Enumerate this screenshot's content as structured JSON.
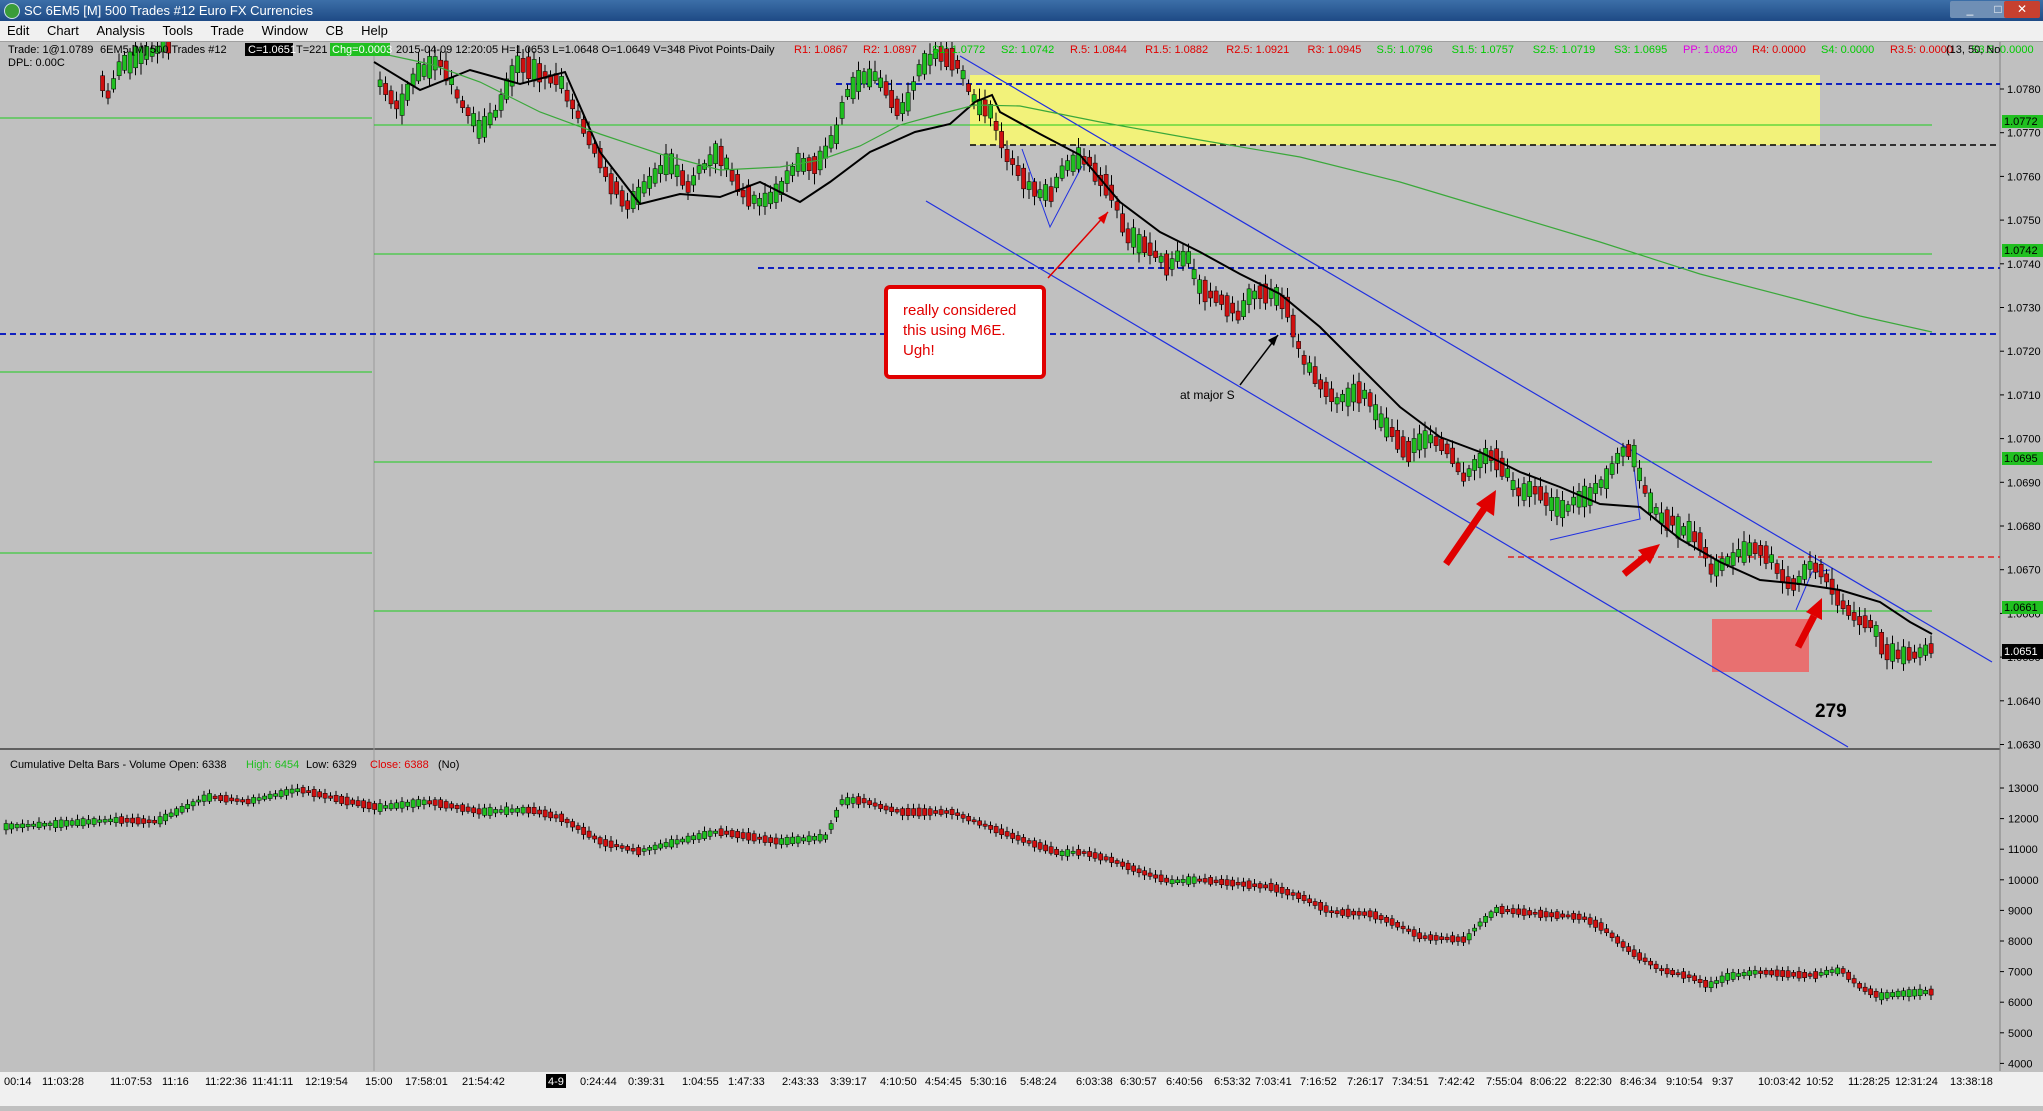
{
  "window": {
    "title": "SC 6EM5 [M]  500 Trades  #12  Euro FX Currencies",
    "minimize": "_",
    "maximize": "□",
    "close": "✕"
  },
  "menu": [
    "Edit",
    "Chart",
    "Analysis",
    "Tools",
    "Trade",
    "Window",
    "CB",
    "Help"
  ],
  "header": {
    "trade": "Trade: 1@1.0789",
    "symbol": "6EM5 [M]  500 Trades  #12",
    "price_box": "C=1.0651",
    "ticks": "T=221",
    "change_box": "Chg=0.0003",
    "ohlc": "2015-04-09 12:20:05 H=1.0653 L=1.0648 O=1.0649 V=348 Pivot Points-Daily",
    "dpl": "DPL: 0.00C",
    "settings": "(13, 50, No",
    "pivots": [
      {
        "text": "R1: 1.0867",
        "color": "#e00000"
      },
      {
        "text": "R2: 1.0897",
        "color": "#e00000"
      },
      {
        "text": "S1: 1.0772",
        "color": "#00cc00"
      },
      {
        "text": "S2: 1.0742",
        "color": "#00cc00"
      },
      {
        "text": "R.5: 1.0844",
        "color": "#e00000"
      },
      {
        "text": "R1.5: 1.0882",
        "color": "#e00000"
      },
      {
        "text": "R2.5: 1.0921",
        "color": "#e00000"
      },
      {
        "text": "R3: 1.0945",
        "color": "#e00000"
      },
      {
        "text": "S.5: 1.0796",
        "color": "#00cc00"
      },
      {
        "text": "S1.5: 1.0757",
        "color": "#00cc00"
      },
      {
        "text": "S2.5: 1.0719",
        "color": "#00cc00"
      },
      {
        "text": "S3: 1.0695",
        "color": "#00cc00"
      },
      {
        "text": "PP: 1.0820",
        "color": "#e000e0"
      },
      {
        "text": "R4: 0.0000",
        "color": "#e00000"
      },
      {
        "text": "S4: 0.0000",
        "color": "#00cc00"
      },
      {
        "text": "R3.5: 0.0000",
        "color": "#e00000"
      },
      {
        "text": "S3.5: 0.0000",
        "color": "#00cc00"
      },
      {
        "text": "R5: 0.0000",
        "color": "#e00000"
      },
      {
        "text": "S5: 0.0000",
        "color": "#00cc00"
      }
    ]
  },
  "price_axis": [
    "1.0780",
    "1.0770",
    "1.0760",
    "1.0750",
    "1.0740",
    "1.0730",
    "1.0720",
    "1.0710",
    "1.0700",
    "1.0690",
    "1.0680",
    "1.0670",
    "1.0660",
    "1.0650",
    "1.0640",
    "1.0630"
  ],
  "price_markers": {
    "s1": "1.0772",
    "s2": "1.0742",
    "s3": "1.0695",
    "s35": "1.0661",
    "last": "1.0651"
  },
  "annotations": {
    "callout": "really considered this using M6E. Ugh!",
    "major_s": "at major S",
    "count": "279"
  },
  "lower_panel": {
    "header": "Cumulative Delta Bars - Volume  Open: 6338",
    "high": "High: 6454",
    "low": "Low: 6329",
    "close": "Close: 6388",
    "no": "(No)",
    "axis": [
      "13000",
      "12000",
      "11000",
      "10000",
      "9000",
      "8000",
      "7000",
      "6000",
      "5000",
      "4000"
    ]
  },
  "time_axis": [
    "00:14",
    "11:03:28",
    "11:07:53",
    "11:16",
    "11:22:36",
    "11:41:11",
    "12:19:54",
    "15:00",
    "17:58:01",
    "21:54:42",
    "4-9",
    "0:24:44",
    "0:39:31",
    "1:04:55",
    "1:47:33",
    "2:43:33",
    "3:39:17",
    "4:10:50",
    "4:54:45",
    "5:30:16",
    "5:48:24",
    "6:03:38",
    "6:30:57",
    "6:40:56",
    "6:53:32",
    "7:03:41",
    "7:16:52",
    "7:26:17",
    "7:34:51",
    "7:42:42",
    "7:55:04",
    "8:06:22",
    "8:22:30",
    "8:46:34",
    "9:10:54",
    "9:37",
    "10:03:42",
    "10:52",
    "11:28:25",
    "12:31:24",
    "13:38:18"
  ],
  "colors": {
    "up": "#20c020",
    "down": "#d01010",
    "channel": "#2030e0",
    "supply_zone": "#f2f27a",
    "demand_zone": "#e87070",
    "grid_green": "#1ecb1e"
  }
}
